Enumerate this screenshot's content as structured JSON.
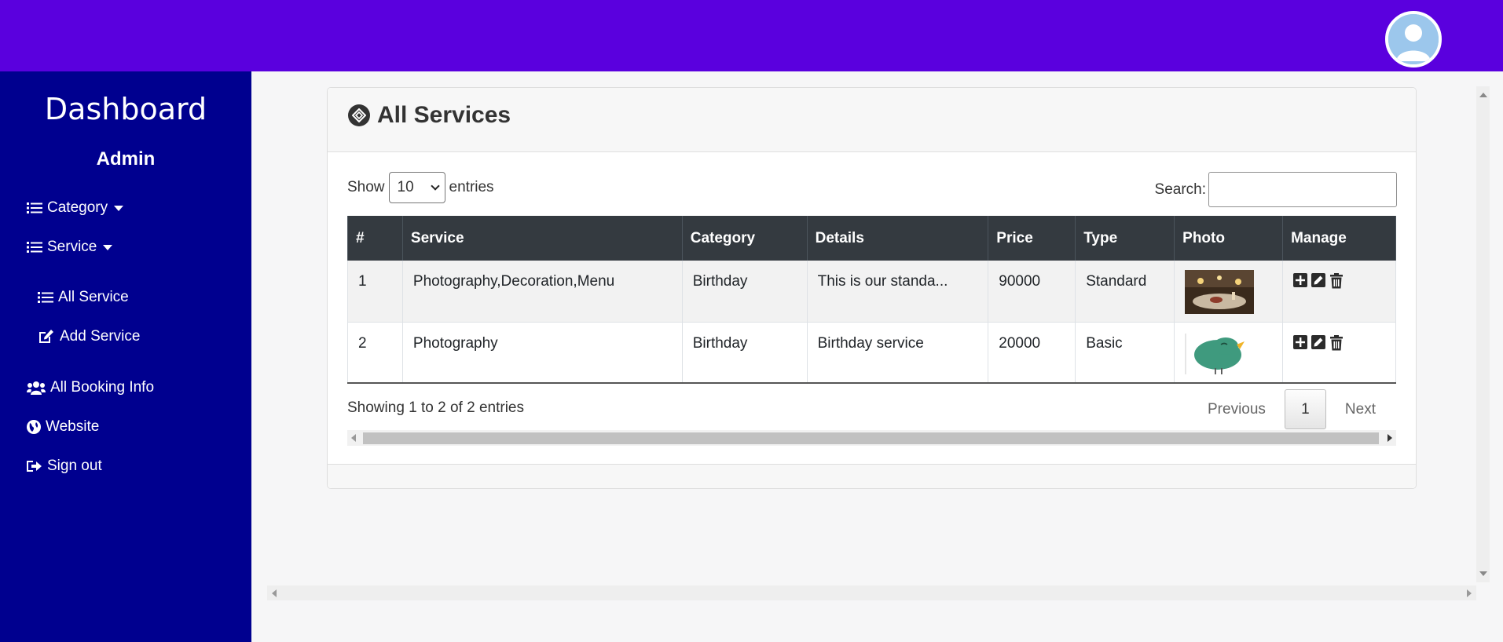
{
  "sidebar": {
    "brand": "Dashboard",
    "role": "Admin",
    "nav": {
      "category": "Category",
      "service": "Service",
      "all_service": "All Service",
      "add_service": "Add Service",
      "all_booking": "All Booking Info",
      "website": "Website",
      "sign_out": "Sign out"
    }
  },
  "card": {
    "title": "All Services",
    "length_prefix": "Show",
    "length_value": "10",
    "length_suffix": "entries",
    "search_label": "Search:",
    "search_value": ""
  },
  "table": {
    "headers": [
      "#",
      "Service",
      "Category",
      "Details",
      "Price",
      "Type",
      "Photo",
      "Manage"
    ],
    "rows": [
      {
        "no": "1",
        "service": "Photography,Decoration,Menu",
        "category": "Birthday",
        "details": "This is our standa...",
        "price": "90000",
        "type": "Standard",
        "photo": "party-table-photo"
      },
      {
        "no": "2",
        "service": "Photography",
        "category": "Birthday",
        "details": "Birthday service",
        "price": "20000",
        "type": "Basic",
        "photo": "green-bird-illustration"
      }
    ]
  },
  "footer": {
    "info": "Showing 1 to 2 of 2 entries",
    "previous": "Previous",
    "page": "1",
    "next": "Next"
  },
  "icons": {
    "avatar": "user-avatar-icon",
    "title": "services-icon",
    "list": "list-icon",
    "edit": "edit-icon",
    "users": "users-icon",
    "globe": "globe-icon",
    "signout": "sign-out-icon",
    "add": "plus-square-icon",
    "trash": "trash-icon"
  },
  "colors": {
    "topbar": "#5a00de",
    "sidebar": "#00008f",
    "table_header": "#343a40"
  }
}
